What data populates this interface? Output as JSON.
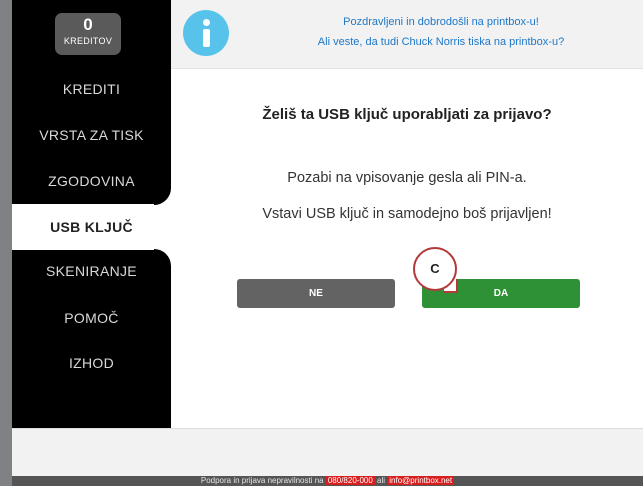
{
  "credits": {
    "value": "0",
    "label": "KREDITOV"
  },
  "sidebar": {
    "items": [
      {
        "label": "KREDITI"
      },
      {
        "label": "VRSTA ZA TISK"
      },
      {
        "label": "ZGODOVINA"
      },
      {
        "label": "USB KLJUČ"
      },
      {
        "label": "SKENIRANJE"
      },
      {
        "label": "POMOČ"
      },
      {
        "label": "IZHOD"
      }
    ],
    "active_index": 3
  },
  "header": {
    "line1": "Pozdravljeni in dobrodošli na printbox-u!",
    "line2": "Ali veste, da tudi Chuck Norris tiska na printbox-u?"
  },
  "main": {
    "question": "Želiš ta USB ključ uporabljati za prijavo?",
    "message1": "Pozabi na vpisovanje gesla ali PIN-a.",
    "message2": "Vstavi USB ključ in samodejno boš prijavljen!",
    "no_label": "NE",
    "yes_label": "DA"
  },
  "callout": {
    "label": "C"
  },
  "footer": {
    "text": "Podpora in prijava nepravilnosti na",
    "phone": "080/820-000",
    "or": "ali",
    "email": "info@printbox.net"
  },
  "colors": {
    "accent_blue": "#1e78c8",
    "info_icon": "#57c3eb",
    "yes_button": "#2e9135",
    "no_button": "#636363",
    "footer_highlight": "#d81f1f"
  }
}
